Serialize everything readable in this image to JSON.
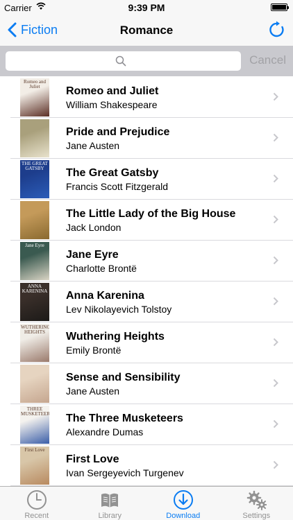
{
  "status_bar": {
    "carrier": "Carrier",
    "time": "9:39 PM"
  },
  "nav": {
    "back_label": "Fiction",
    "title": "Romance"
  },
  "search": {
    "placeholder": "",
    "cancel_label": "Cancel"
  },
  "books": [
    {
      "title": "Romeo and Juliet",
      "author": "William Shakespeare",
      "cover_text": "Romeo and Juliet",
      "cover_colors": [
        "#f2ede6",
        "#5c2f25"
      ]
    },
    {
      "title": "Pride and Prejudice",
      "author": "Jane Austen",
      "cover_text": "",
      "cover_colors": [
        "#a9a07c",
        "#e8e2cc"
      ]
    },
    {
      "title": "The Great Gatsby",
      "author": "Francis Scott Fitzgerald",
      "cover_text": "THE GREAT GATSBY",
      "cover_colors": [
        "#1d3d8c",
        "#2b5cb8"
      ]
    },
    {
      "title": "The Little Lady of the Big House",
      "author": "Jack London",
      "cover_text": "",
      "cover_colors": [
        "#c49a5a",
        "#8a6a30"
      ]
    },
    {
      "title": "Jane Eyre",
      "author": "Charlotte Brontë",
      "cover_text": "Jane Eyre",
      "cover_colors": [
        "#3a5a50",
        "#d9d4c4"
      ]
    },
    {
      "title": "Anna Karenina",
      "author": "Lev Nikolayevich Tolstoy",
      "cover_text": "ANNA KARENINA",
      "cover_colors": [
        "#3a2f2a",
        "#1c1a18"
      ]
    },
    {
      "title": "Wuthering Heights",
      "author": "Emily Brontë",
      "cover_text": "WUTHERING HEIGHTS",
      "cover_colors": [
        "#efece6",
        "#9a7a6c"
      ]
    },
    {
      "title": "Sense and Sensibility",
      "author": "Jane Austen",
      "cover_text": "",
      "cover_colors": [
        "#e6d4c0",
        "#c5a68f"
      ]
    },
    {
      "title": "The Three Musketeers",
      "author": "Alexandre Dumas",
      "cover_text": "THREE MUSKETEERS",
      "cover_colors": [
        "#f4f2ee",
        "#3a5ea8"
      ]
    },
    {
      "title": "First Love",
      "author": "Ivan Sergeyevich Turgenev",
      "cover_text": "First Love",
      "cover_colors": [
        "#d8c6a8",
        "#b88a60"
      ]
    }
  ],
  "tabs": [
    {
      "label": "Recent",
      "icon": "clock-icon",
      "active": false
    },
    {
      "label": "Library",
      "icon": "book-icon",
      "active": false
    },
    {
      "label": "Download",
      "icon": "download-icon",
      "active": true
    },
    {
      "label": "Settings",
      "icon": "gears-icon",
      "active": false
    }
  ],
  "colors": {
    "accent": "#0a7cf2",
    "inactive": "#929292",
    "search_bg": "#c9c9ce"
  }
}
